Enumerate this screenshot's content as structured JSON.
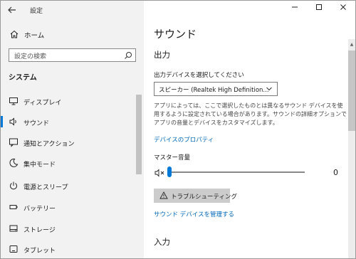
{
  "window": {
    "title": "設定",
    "controls": [
      "—",
      "□",
      "✕"
    ]
  },
  "sidebar": {
    "home_label": "ホーム",
    "search_placeholder": "設定の検索",
    "section_heading": "システム",
    "items": [
      {
        "label": "ディスプレイ",
        "icon": "display-icon",
        "selected": false
      },
      {
        "label": "サウンド",
        "icon": "speaker-icon",
        "selected": true
      },
      {
        "label": "通知とアクション",
        "icon": "notification-icon",
        "selected": false
      },
      {
        "label": "集中モード",
        "icon": "moon-icon",
        "selected": false
      },
      {
        "label": "電源とスリープ",
        "icon": "power-icon",
        "selected": false
      },
      {
        "label": "バッテリー",
        "icon": "battery-icon",
        "selected": false
      },
      {
        "label": "ストレージ",
        "icon": "storage-icon",
        "selected": false
      },
      {
        "label": "タブレット",
        "icon": "tablet-icon",
        "selected": false
      }
    ]
  },
  "main": {
    "title": "サウンド",
    "output_heading": "出力",
    "device_select_label": "出力デバイスを選択してください",
    "device_selected": "スピーカー (Realtek High Definition...",
    "description": "アプリによっては、ここで選択したものとは異なるサウンド デバイスを使用するように設定されている場合があります。サウンドの詳細オプションでアプリの音量とデバイスをカスタマイズします。",
    "device_properties_link": "デバイスのプロパティ",
    "master_volume_label": "マスター音量",
    "master_volume_value": "0",
    "troubleshoot_label": "トラブルシューティング",
    "manage_devices_link": "サウンド デバイスを管理する",
    "input_heading": "入力"
  },
  "colors": {
    "accent": "#0078d7",
    "link": "#0067b8",
    "sidebar_bg": "#f2f2f2"
  }
}
